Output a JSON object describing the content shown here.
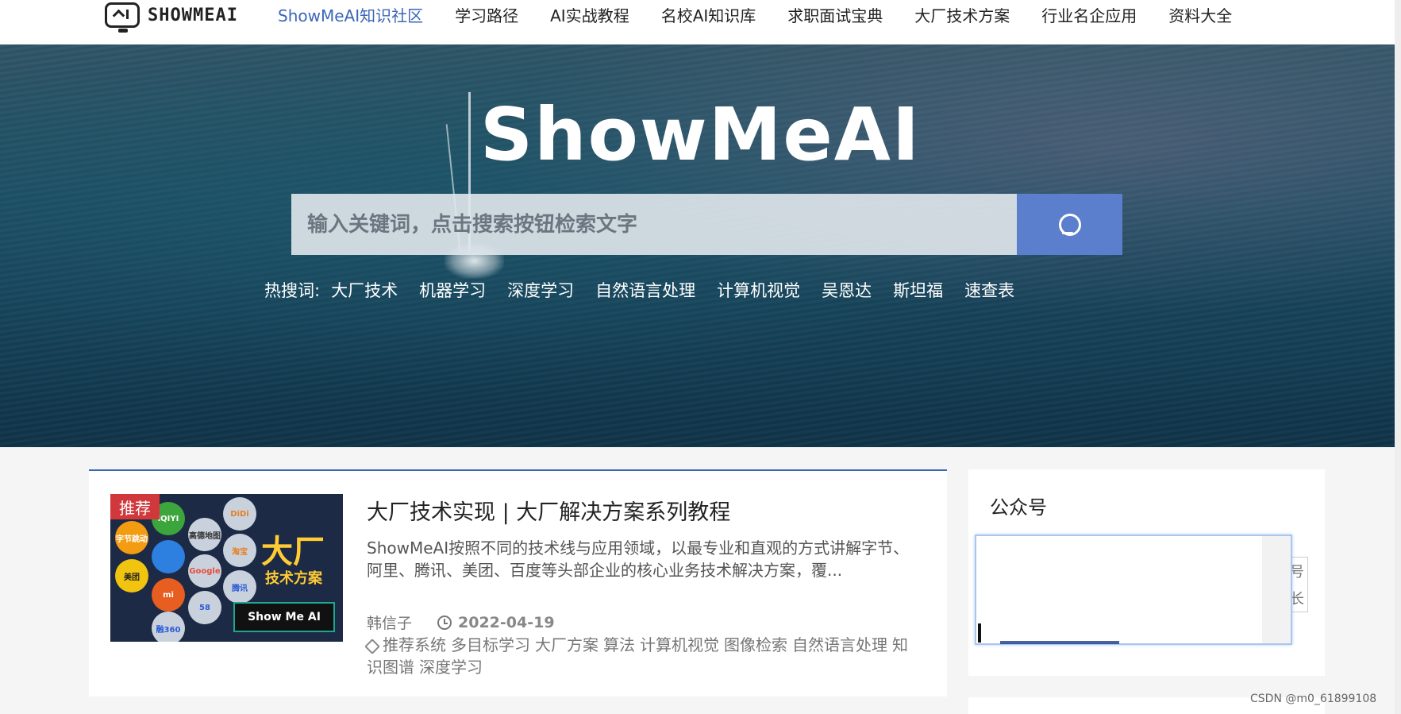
{
  "nav": {
    "logo_text": "SHOWMEAI",
    "items": [
      {
        "label": "ShowMeAI知识社区",
        "active": true
      },
      {
        "label": "学习路径"
      },
      {
        "label": "AI实战教程"
      },
      {
        "label": "名校AI知识库"
      },
      {
        "label": "求职面试宝典"
      },
      {
        "label": "大厂技术方案"
      },
      {
        "label": "行业名企应用"
      },
      {
        "label": "资料大全"
      }
    ]
  },
  "hero": {
    "title": "ShowMeAI",
    "search_placeholder": "输入关键词，点击搜索按钮检索文字",
    "hot_label": "热搜词:",
    "hot_words": [
      "大厂技术",
      "机器学习",
      "深度学习",
      "自然语言处理",
      "计算机视觉",
      "吴恩达",
      "斯坦福",
      "速查表"
    ]
  },
  "article": {
    "rec_tag": "推荐",
    "thumb_title": "大厂",
    "thumb_sub": "技术方案",
    "thumb_badge": "Show Me AI",
    "thumb_logos": [
      "字节跳动",
      "DiDi",
      "iQIYI",
      "高德地图",
      "美团",
      "Google",
      "淘宝",
      "mi",
      "腾讯",
      "58",
      "融360"
    ],
    "title": "大厂技术实现 | 大厂解决方案系列教程",
    "desc": "ShowMeAI按照不同的技术线与应用领域，以最专业和直观的方式讲解字节、阿里、腾讯、美团、百度等头部企业的核心业务技术解决方案，覆...",
    "author": "韩信子",
    "date": "2022-04-19",
    "tags": [
      "推荐系统",
      "多目标学习",
      "大厂方案",
      "算法",
      "计算机视觉",
      "图像检索",
      "自然语言处理",
      "知识图谱",
      "深度学习"
    ]
  },
  "sidebar": {
    "title": "公众号",
    "peek_chars": [
      "号",
      "长"
    ]
  },
  "watermark": "CSDN @m0_61899108",
  "colors": {
    "accent": "#3b66b8",
    "search_button": "#5b7fcc",
    "rec_tag": "#d0383c"
  }
}
